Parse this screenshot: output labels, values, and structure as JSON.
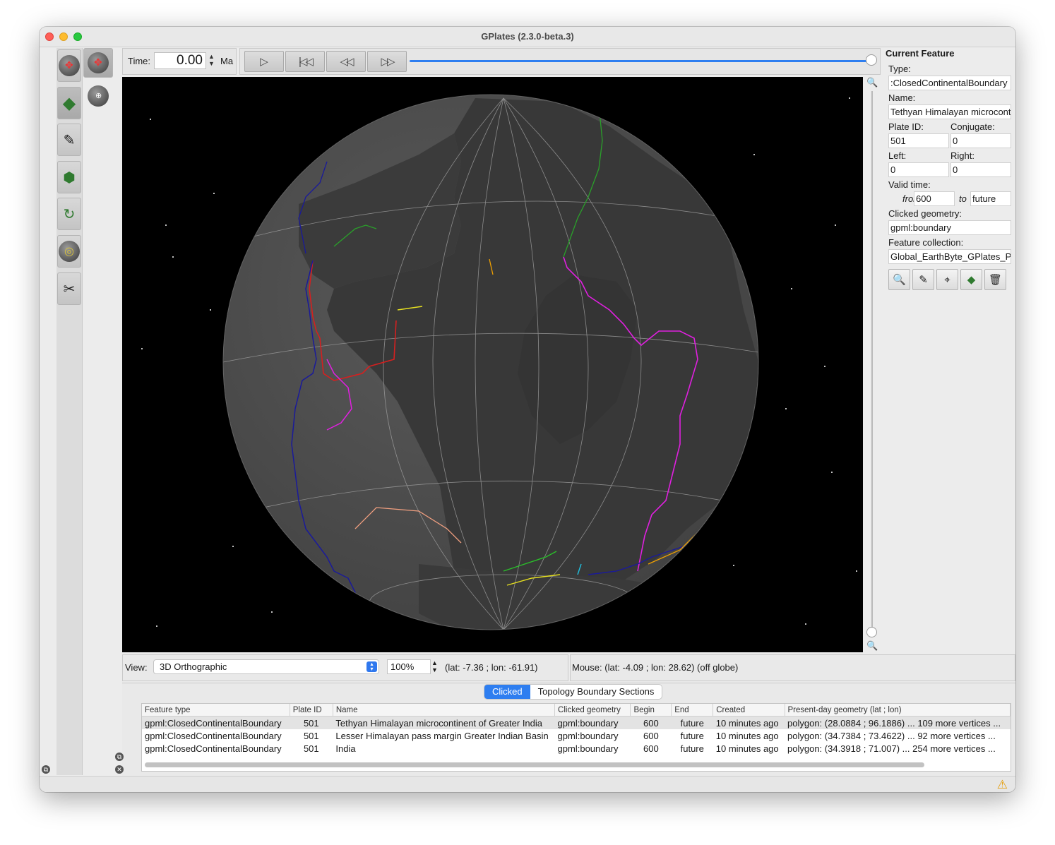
{
  "window": {
    "title": "GPlates (2.3.0-beta.3)"
  },
  "time_bar": {
    "label": "Time:",
    "value": "0.00",
    "unit": "Ma"
  },
  "playback": {
    "play_icon": "play-icon",
    "rewind_start_icon": "rewind-to-start-icon",
    "step_back_icon": "step-back-icon",
    "step_forward_icon": "step-forward-icon",
    "slider_position_fraction": 1.0
  },
  "current_feature": {
    "heading": "Current Feature",
    "type_label": "Type:",
    "type_value": ":ClosedContinentalBoundary",
    "name_label": "Name:",
    "name_value": "Tethyan Himalayan microcontinent of Greater India",
    "plate_id_label": "Plate ID:",
    "plate_id_value": "501",
    "conjugate_label": "Conjugate:",
    "conjugate_value": "0",
    "left_label": "Left:",
    "left_value": "0",
    "right_label": "Right:",
    "right_value": "0",
    "valid_time_label": "Valid time:",
    "from_label": "from",
    "from_value": "600",
    "to_label": "to",
    "to_value": "future",
    "clicked_geometry_label": "Clicked geometry:",
    "clicked_geometry_value": "gpml:boundary",
    "feature_collection_label": "Feature collection:",
    "feature_collection_value": "Global_EarthByte_GPlates_P"
  },
  "view_bar": {
    "label": "View:",
    "projection": "3D Orthographic",
    "zoom": "100%",
    "camera_latlon": "(lat: -7.36 ; lon: -61.91)"
  },
  "mouse_bar": {
    "text": "Mouse: (lat: -4.09 ; lon: 28.62) (off globe)"
  },
  "dock": {
    "tabs": [
      {
        "label": "Clicked",
        "active": true
      },
      {
        "label": "Topology Boundary Sections",
        "active": false
      }
    ],
    "columns": [
      "Feature type",
      "Plate ID",
      "Name",
      "Clicked geometry",
      "Begin",
      "End",
      "Created",
      "Present-day geometry (lat ; lon)"
    ],
    "rows": [
      [
        "gpml:ClosedContinentalBoundary",
        "501",
        "Tethyan Himalayan microcontinent of Greater India",
        "gpml:boundary",
        "600",
        "future",
        "10 minutes ago",
        "polygon: (28.0884 ; 96.1886) ... 109 more vertices ..."
      ],
      [
        "gpml:ClosedContinentalBoundary",
        "501",
        "Lesser Himalayan pass margin Greater Indian Basin",
        "gpml:boundary",
        "600",
        "future",
        "10 minutes ago",
        "polygon: (34.7384 ; 73.4622) ... 92 more vertices ..."
      ],
      [
        "gpml:ClosedContinentalBoundary",
        "501",
        "India",
        "gpml:boundary",
        "600",
        "future",
        "10 minutes ago",
        "polygon: (34.3918 ; 71.007) ... 254 more vertices ..."
      ]
    ]
  },
  "colors": {
    "accent": "#2e7ef0",
    "globe_ocean": "#4b4b4b",
    "globe_land": "#383838",
    "space": "#000000",
    "ridge_magenta": "#e020e0",
    "subduction_blue": "#1a1a9a",
    "fault_red": "#d42020"
  }
}
